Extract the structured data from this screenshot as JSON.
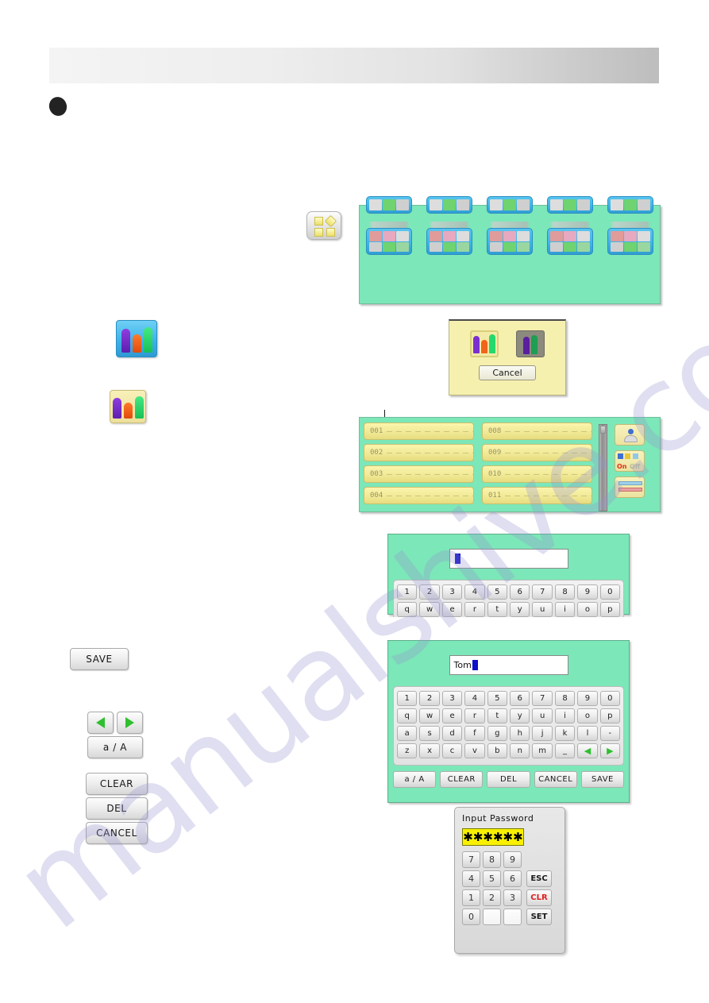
{
  "watermark": {
    "text": "manualshive.com"
  },
  "header": {
    "title": ""
  },
  "icon_grid_panel": {
    "name": "program-select-screen",
    "row1": [
      {
        "label": "",
        "cells": [
          "c3",
          "c5",
          "c4"
        ]
      },
      {
        "label": "",
        "cells": [
          "c3",
          "c5",
          "c4"
        ]
      },
      {
        "label": "",
        "cells": [
          "c3",
          "c5",
          "c4"
        ]
      },
      {
        "label": "",
        "cells": [
          "c3",
          "c5",
          "c4"
        ]
      },
      {
        "label": "",
        "cells": [
          "c3",
          "c5",
          "c4"
        ]
      }
    ],
    "row2": [
      {
        "label": "",
        "cells": [
          "c1",
          "c2",
          "c3",
          "c4",
          "c5",
          "c6"
        ]
      },
      {
        "label": "",
        "cells": [
          "c1",
          "c2",
          "c3",
          "c4",
          "c5",
          "c6"
        ]
      },
      {
        "label": "",
        "cells": [
          "c1",
          "c2",
          "c3",
          "c4",
          "c5",
          "c6"
        ]
      },
      {
        "label": "",
        "cells": [
          "c1",
          "c2",
          "c3",
          "c4",
          "c5",
          "c6"
        ]
      },
      {
        "label": "",
        "cells": [
          "c1",
          "c2",
          "c3",
          "c4",
          "c5",
          "c6"
        ]
      }
    ]
  },
  "shapes_button": {
    "icon": "four-shapes-icon"
  },
  "select_dialog": {
    "option_enabled_icon": "group-people-icon",
    "option_disabled_icon": "group-people-disabled-icon",
    "cancel_label": "Cancel"
  },
  "list_panel": {
    "left_column": [
      {
        "number": "001"
      },
      {
        "number": "002"
      },
      {
        "number": "003"
      },
      {
        "number": "004"
      }
    ],
    "right_column": [
      {
        "number": "008"
      },
      {
        "number": "009"
      },
      {
        "number": "010"
      },
      {
        "number": "011"
      }
    ],
    "side_buttons": [
      {
        "name": "user-icon"
      },
      {
        "name": "on-off-icon",
        "on_label": "On",
        "off_label": "Off"
      },
      {
        "name": "machine-icon"
      }
    ],
    "scrollbar": {
      "name": "vertical-scrollbar"
    }
  },
  "keyboard_empty": {
    "display_value": "",
    "rows": [
      [
        "1",
        "2",
        "3",
        "4",
        "5",
        "6",
        "7",
        "8",
        "9",
        "0"
      ],
      [
        "q",
        "w",
        "e",
        "r",
        "t",
        "y",
        "u",
        "i",
        "o",
        "p"
      ]
    ]
  },
  "keyboard_full": {
    "display_value": "Tom",
    "rows": [
      [
        "1",
        "2",
        "3",
        "4",
        "5",
        "6",
        "7",
        "8",
        "9",
        "0"
      ],
      [
        "q",
        "w",
        "e",
        "r",
        "t",
        "y",
        "u",
        "i",
        "o",
        "p"
      ],
      [
        "a",
        "s",
        "d",
        "f",
        "g",
        "h",
        "j",
        "k",
        "l",
        "-"
      ],
      [
        "z",
        "x",
        "c",
        "v",
        "b",
        "n",
        "m",
        "_",
        "◀",
        "▶"
      ]
    ],
    "footer": [
      "a / A",
      "CLEAR",
      "DEL",
      "CANCEL",
      "SAVE"
    ]
  },
  "password_panel": {
    "title": "Input Password",
    "display_value": "✱✱✱✱✱✱",
    "keys": [
      "7",
      "8",
      "9",
      "4",
      "5",
      "6",
      "1",
      "2",
      "3",
      "0",
      "",
      ""
    ],
    "actions": [
      "ESC",
      "CLR",
      "SET"
    ]
  },
  "callout_buttons": {
    "save": "SAVE",
    "case": "a / A",
    "clear": "CLEAR",
    "del": "DEL",
    "cancel": "CANCEL",
    "arrow_left": "left-arrow-icon",
    "arrow_right": "right-arrow-icon"
  },
  "side_icons": {
    "group_blue": "group-people-blue-icon",
    "group_yellow": "group-people-yellow-icon"
  },
  "colors": {
    "screen_green": "#7ce7b8",
    "row_yellow": "#f0e893",
    "dialog_yellow": "#f5f0ae",
    "tile_blue": "#3fb6ea",
    "accent_green": "#2fbf2f",
    "alert_red": "#e02020",
    "password_yellow": "#f8f000"
  }
}
